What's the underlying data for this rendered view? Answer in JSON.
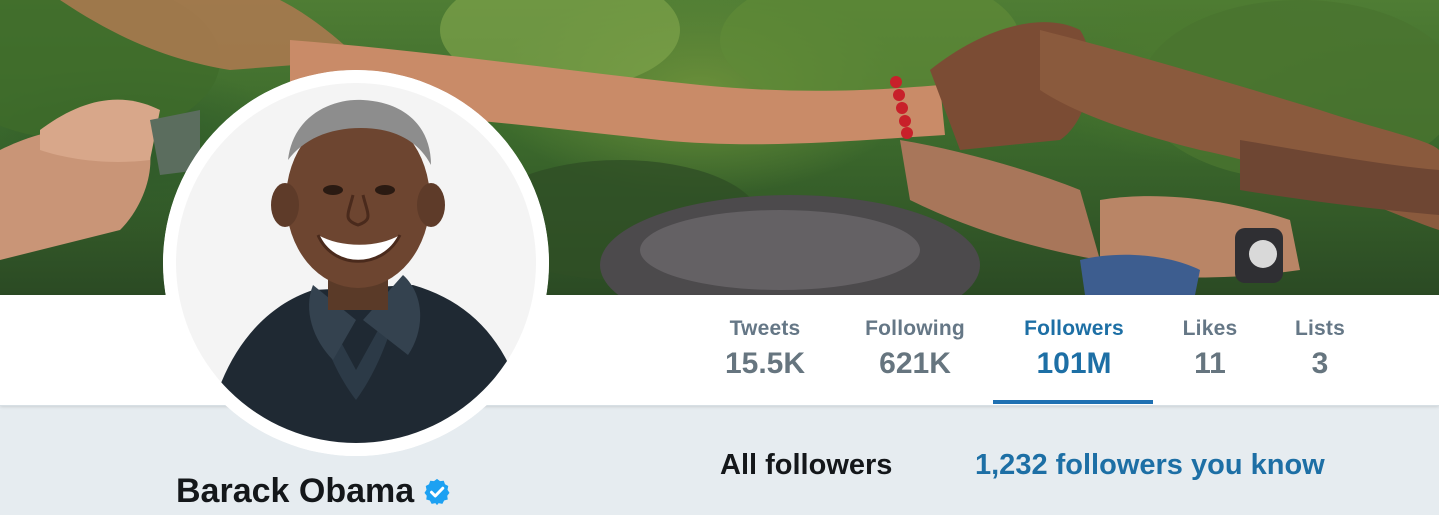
{
  "profile": {
    "name": "Barack Obama",
    "verified": true
  },
  "stats": [
    {
      "label": "Tweets",
      "value": "15.5K",
      "active": false
    },
    {
      "label": "Following",
      "value": "621K",
      "active": false
    },
    {
      "label": "Followers",
      "value": "101M",
      "active": true
    },
    {
      "label": "Likes",
      "value": "11",
      "active": false
    },
    {
      "label": "Lists",
      "value": "3",
      "active": false
    }
  ],
  "followers_tabs": {
    "all": "All followers",
    "known": "1,232 followers you know"
  },
  "colors": {
    "accent": "#1d6fa5",
    "muted": "#657786",
    "text": "#14171a",
    "background": "#e6ecf0",
    "verified_badge": "#1da1f2"
  },
  "icons": {
    "verified": "verified-badge-icon"
  }
}
